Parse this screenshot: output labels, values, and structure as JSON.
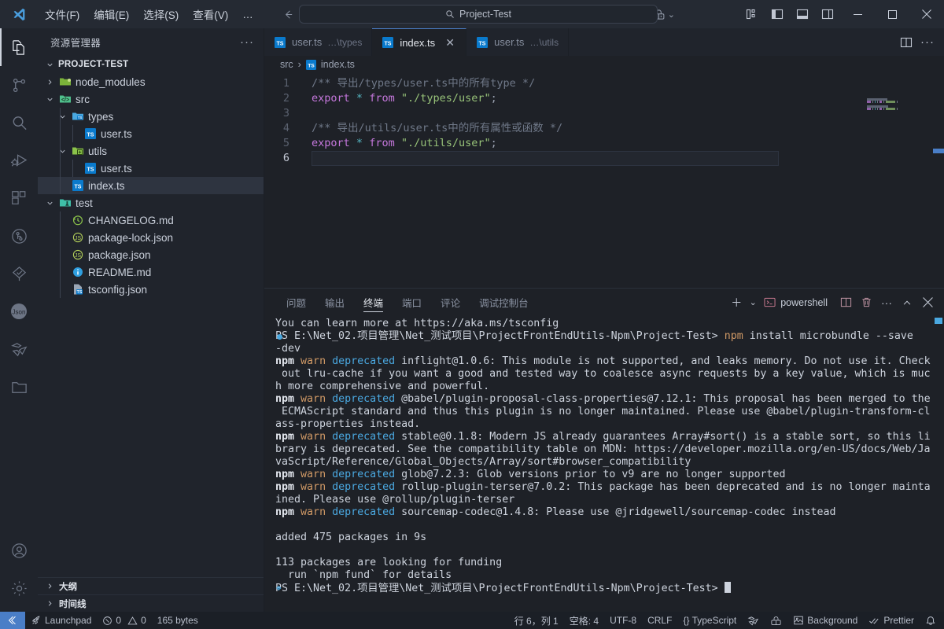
{
  "titlebar": {
    "menus": [
      "文件(F)",
      "编辑(E)",
      "选择(S)",
      "查看(V)",
      "…"
    ],
    "back_icon": "arrow-left-icon",
    "forward_icon": "arrow-right-icon",
    "command_center_text": "Project-Test",
    "search_icon": "search-icon",
    "remote_icon": "remote-accounts-icon",
    "chevron": "⌄",
    "layout_buttons": [
      "customize-layout-icon",
      "toggle-primary-sidebar-icon",
      "toggle-panel-icon",
      "toggle-secondary-sidebar-icon"
    ],
    "window_minimize": "−",
    "window_maximize": "▢",
    "window_close": "✕"
  },
  "activitybar": {
    "items": [
      {
        "name": "explorer-icon",
        "active": true
      },
      {
        "name": "source-control-icon",
        "active": false
      },
      {
        "name": "search-icon",
        "active": false
      },
      {
        "name": "run-and-debug-icon",
        "active": false
      },
      {
        "name": "extensions-icon",
        "active": false
      },
      {
        "name": "git-graph-icon",
        "active": false
      },
      {
        "name": "testing-tree-icon",
        "active": false
      },
      {
        "name": "json-icon",
        "active": false
      },
      {
        "name": "vue-icon",
        "active": false
      },
      {
        "name": "folder-icon",
        "active": false
      }
    ],
    "bottom": [
      {
        "name": "accounts-icon"
      },
      {
        "name": "settings-gear-icon"
      }
    ]
  },
  "sidebar": {
    "title": "资源管理器",
    "more_actions": "···",
    "root_label": "PROJECT-TEST",
    "tree": [
      {
        "label": "node_modules",
        "depth": 1,
        "twisty": "collapsed",
        "icon": "folder-node-modules-icon",
        "selected": false
      },
      {
        "label": "src",
        "depth": 1,
        "twisty": "expanded",
        "icon": "folder-src-icon",
        "selected": false
      },
      {
        "label": "types",
        "depth": 2,
        "twisty": "expanded",
        "icon": "folder-types-icon",
        "selected": false
      },
      {
        "label": "user.ts",
        "depth": 3,
        "twisty": "none",
        "icon": "typescript-file-icon",
        "selected": false
      },
      {
        "label": "utils",
        "depth": 2,
        "twisty": "expanded",
        "icon": "folder-utils-icon",
        "selected": false
      },
      {
        "label": "user.ts",
        "depth": 3,
        "twisty": "none",
        "icon": "typescript-file-icon",
        "selected": false
      },
      {
        "label": "index.ts",
        "depth": 2,
        "twisty": "none",
        "icon": "typescript-file-icon",
        "selected": true
      },
      {
        "label": "test",
        "depth": 1,
        "twisty": "expanded",
        "icon": "folder-test-icon",
        "selected": false
      },
      {
        "label": "CHANGELOG.md",
        "depth": 2,
        "twisty": "none",
        "icon": "changelog-icon",
        "selected": false
      },
      {
        "label": "package-lock.json",
        "depth": 2,
        "twisty": "none",
        "icon": "npm-lock-icon",
        "selected": false
      },
      {
        "label": "package.json",
        "depth": 2,
        "twisty": "none",
        "icon": "npm-icon",
        "selected": false
      },
      {
        "label": "README.md",
        "depth": 2,
        "twisty": "none",
        "icon": "readme-info-icon",
        "selected": false
      },
      {
        "label": "tsconfig.json",
        "depth": 2,
        "twisty": "none",
        "icon": "tsconfig-icon",
        "selected": false
      }
    ],
    "sections": [
      {
        "label": "大纲",
        "state": "collapsed"
      },
      {
        "label": "时间线",
        "state": "collapsed"
      }
    ]
  },
  "editor": {
    "tabs": [
      {
        "label": "user.ts",
        "sub": "…\\types",
        "active": false,
        "icon": "typescript-file-icon",
        "closable": false
      },
      {
        "label": "index.ts",
        "sub": "",
        "active": true,
        "icon": "typescript-file-icon",
        "closable": true
      },
      {
        "label": "user.ts",
        "sub": "…\\utils",
        "active": false,
        "icon": "typescript-file-icon",
        "closable": false
      }
    ],
    "tab_close_glyph": "✕",
    "editor_actions": [
      "split-editor-icon",
      "more-actions-icon"
    ],
    "breadcrumb": [
      "src",
      "index.ts"
    ],
    "breadcrumb_separator": "›",
    "line_numbers": [
      "1",
      "2",
      "3",
      "4",
      "5",
      "6"
    ],
    "current_line": 6,
    "code": [
      [
        {
          "t": "/** 导出/types/user.ts中的所有type */",
          "c": "t-com"
        }
      ],
      [
        {
          "t": "export",
          "c": "t-kw"
        },
        {
          "t": " ",
          "c": "t-pun"
        },
        {
          "t": "*",
          "c": "t-op"
        },
        {
          "t": " ",
          "c": "t-pun"
        },
        {
          "t": "from",
          "c": "t-kw"
        },
        {
          "t": " ",
          "c": "t-pun"
        },
        {
          "t": "\"./types/user\"",
          "c": "t-str"
        },
        {
          "t": ";",
          "c": "t-pun"
        }
      ],
      [],
      [
        {
          "t": "/** 导出/utils/user.ts中的所有属性或函数 */",
          "c": "t-com"
        }
      ],
      [
        {
          "t": "export",
          "c": "t-kw"
        },
        {
          "t": " ",
          "c": "t-pun"
        },
        {
          "t": "*",
          "c": "t-op"
        },
        {
          "t": " ",
          "c": "t-pun"
        },
        {
          "t": "from",
          "c": "t-kw"
        },
        {
          "t": " ",
          "c": "t-pun"
        },
        {
          "t": "\"./utils/user\"",
          "c": "t-str"
        },
        {
          "t": ";",
          "c": "t-pun"
        }
      ],
      []
    ]
  },
  "panel": {
    "tabs": [
      {
        "label": "问题",
        "active": false
      },
      {
        "label": "输出",
        "active": false
      },
      {
        "label": "终端",
        "active": true
      },
      {
        "label": "端口",
        "active": false
      },
      {
        "label": "评论",
        "active": false
      },
      {
        "label": "调试控制台",
        "active": false
      }
    ],
    "new_terminal": "＋",
    "new_terminal_chevron": "⌄",
    "terminal_name": "powershell",
    "terminal_icon": "terminal-powershell-icon",
    "split_icon": "split-terminal-icon",
    "kill_icon": "trash-icon",
    "more_icon": "···",
    "maximize_icon": "chevron-up-icon",
    "close_icon": "✕",
    "terminal_lines": [
      {
        "mark": "none",
        "parts": [
          {
            "t": "You can learn more at https://aka.ms/tsconfig",
            "c": ""
          }
        ]
      },
      {
        "mark": "dot",
        "parts": [
          {
            "t": "PS E:\\Net_02.项目管理\\Net_测试项目\\ProjectFrontEndUtils-Npm\\Project-Test> ",
            "c": ""
          },
          {
            "t": "npm",
            "c": "o"
          },
          {
            "t": " install microbundle --save",
            "c": ""
          }
        ]
      },
      {
        "mark": "none",
        "parts": [
          {
            "t": "-dev",
            "c": ""
          }
        ]
      },
      {
        "mark": "none",
        "parts": [
          {
            "t": "npm",
            "c": "w"
          },
          {
            "t": " ",
            "c": ""
          },
          {
            "t": "warn",
            "c": "o"
          },
          {
            "t": " ",
            "c": ""
          },
          {
            "t": "deprecated",
            "c": "c"
          },
          {
            "t": " inflight@1.0.6: This module is not supported, and leaks memory. Do not use it. Check",
            "c": ""
          }
        ]
      },
      {
        "mark": "none",
        "parts": [
          {
            "t": " out lru-cache if you want a good and tested way to coalesce async requests by a key value, which is muc",
            "c": ""
          }
        ]
      },
      {
        "mark": "none",
        "parts": [
          {
            "t": "h more comprehensive and powerful.",
            "c": ""
          }
        ]
      },
      {
        "mark": "none",
        "parts": [
          {
            "t": "npm",
            "c": "w"
          },
          {
            "t": " ",
            "c": ""
          },
          {
            "t": "warn",
            "c": "o"
          },
          {
            "t": " ",
            "c": ""
          },
          {
            "t": "deprecated",
            "c": "c"
          },
          {
            "t": " @babel/plugin-proposal-class-properties@7.12.1: This proposal has been merged to the",
            "c": ""
          }
        ]
      },
      {
        "mark": "none",
        "parts": [
          {
            "t": " ECMAScript standard and thus this plugin is no longer maintained. Please use @babel/plugin-transform-cl",
            "c": ""
          }
        ]
      },
      {
        "mark": "none",
        "parts": [
          {
            "t": "ass-properties instead.",
            "c": ""
          }
        ]
      },
      {
        "mark": "none",
        "parts": [
          {
            "t": "npm",
            "c": "w"
          },
          {
            "t": " ",
            "c": ""
          },
          {
            "t": "warn",
            "c": "o"
          },
          {
            "t": " ",
            "c": ""
          },
          {
            "t": "deprecated",
            "c": "c"
          },
          {
            "t": " stable@0.1.8: Modern JS already guarantees Array#sort() is a stable sort, so this li",
            "c": ""
          }
        ]
      },
      {
        "mark": "none",
        "parts": [
          {
            "t": "brary is deprecated. See the compatibility table on MDN: https://developer.mozilla.org/en-US/docs/Web/Ja",
            "c": ""
          }
        ]
      },
      {
        "mark": "none",
        "parts": [
          {
            "t": "vaScript/Reference/Global_Objects/Array/sort#browser_compatibility",
            "c": ""
          }
        ]
      },
      {
        "mark": "none",
        "parts": [
          {
            "t": "npm",
            "c": "w"
          },
          {
            "t": " ",
            "c": ""
          },
          {
            "t": "warn",
            "c": "o"
          },
          {
            "t": " ",
            "c": ""
          },
          {
            "t": "deprecated",
            "c": "c"
          },
          {
            "t": " glob@7.2.3: Glob versions prior to v9 are no longer supported",
            "c": ""
          }
        ]
      },
      {
        "mark": "none",
        "parts": [
          {
            "t": "npm",
            "c": "w"
          },
          {
            "t": " ",
            "c": ""
          },
          {
            "t": "warn",
            "c": "o"
          },
          {
            "t": " ",
            "c": ""
          },
          {
            "t": "deprecated",
            "c": "c"
          },
          {
            "t": " rollup-plugin-terser@7.0.2: This package has been deprecated and is no longer mainta",
            "c": ""
          }
        ]
      },
      {
        "mark": "none",
        "parts": [
          {
            "t": "ined. Please use @rollup/plugin-terser",
            "c": ""
          }
        ]
      },
      {
        "mark": "none",
        "parts": [
          {
            "t": "npm",
            "c": "w"
          },
          {
            "t": " ",
            "c": ""
          },
          {
            "t": "warn",
            "c": "o"
          },
          {
            "t": " ",
            "c": ""
          },
          {
            "t": "deprecated",
            "c": "c"
          },
          {
            "t": " sourcemap-codec@1.4.8: Please use @jridgewell/sourcemap-codec instead",
            "c": ""
          }
        ]
      },
      {
        "mark": "none",
        "parts": [
          {
            "t": "",
            "c": ""
          }
        ]
      },
      {
        "mark": "none",
        "parts": [
          {
            "t": "added 475 packages in 9s",
            "c": ""
          }
        ]
      },
      {
        "mark": "none",
        "parts": [
          {
            "t": "",
            "c": ""
          }
        ]
      },
      {
        "mark": "none",
        "parts": [
          {
            "t": "113 packages are looking for funding",
            "c": ""
          }
        ]
      },
      {
        "mark": "none",
        "parts": [
          {
            "t": "  run `npm fund` for details",
            "c": ""
          }
        ]
      },
      {
        "mark": "diamond",
        "parts": [
          {
            "t": "PS E:\\Net_02.项目管理\\Net_测试项目\\ProjectFrontEndUtils-Npm\\Project-Test> ",
            "c": ""
          }
        ],
        "cursor": true
      }
    ]
  },
  "statusbar": {
    "remote_icon": "remote-window-icon",
    "left": [
      {
        "icon": "rocket-icon",
        "label": "Launchpad"
      },
      {
        "icon": "error-warning-icon",
        "label": "0  0",
        "errors": "0",
        "warnings": "0"
      },
      {
        "icon": "",
        "label": "165 bytes"
      }
    ],
    "errors_count": "0",
    "warnings_count": "0",
    "size_label": "165 bytes",
    "launchpad_label": "Launchpad",
    "right": [
      {
        "name": "cursor-position",
        "label": "行 6，列 1"
      },
      {
        "name": "indentation",
        "label": "空格: 4"
      },
      {
        "name": "encoding",
        "label": "UTF-8"
      },
      {
        "name": "eol",
        "label": "CRLF"
      },
      {
        "name": "language-mode",
        "label": "{} TypeScript"
      },
      {
        "name": "vue-volar-icon",
        "label": ""
      },
      {
        "name": "remote-accounts-icon",
        "label": ""
      },
      {
        "name": "background-tasks",
        "label": "Background"
      },
      {
        "name": "prettier",
        "label": "Prettier"
      },
      {
        "name": "notifications-bell-icon",
        "label": ""
      }
    ]
  }
}
